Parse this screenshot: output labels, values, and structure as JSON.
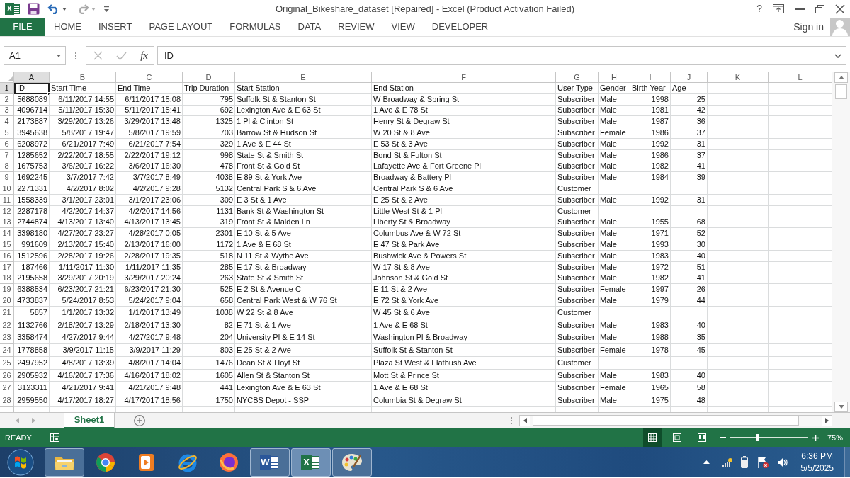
{
  "title_bar": {
    "app_letter": "X",
    "title": "Original_Bikeshare_dataset [Repaired] - Excel (Product Activation Failed)",
    "help": "?"
  },
  "ribbon": {
    "tabs": [
      {
        "label": "FILE",
        "kind": "file"
      },
      {
        "label": "HOME",
        "kind": "tab"
      },
      {
        "label": "INSERT",
        "kind": "tab"
      },
      {
        "label": "PAGE LAYOUT",
        "kind": "tab"
      },
      {
        "label": "FORMULAS",
        "kind": "tab"
      },
      {
        "label": "DATA",
        "kind": "tab"
      },
      {
        "label": "REVIEW",
        "kind": "tab"
      },
      {
        "label": "VIEW",
        "kind": "tab"
      },
      {
        "label": "DEVELOPER",
        "kind": "tab"
      }
    ],
    "account": {
      "label": "Sign in"
    }
  },
  "formula_bar": {
    "name_box": "A1",
    "function_label": "fx",
    "value": "ID"
  },
  "sheet": {
    "columns": [
      {
        "label": "A",
        "kind": "number",
        "selected": true
      },
      {
        "label": "B",
        "kind": "number",
        "selected": false
      },
      {
        "label": "C",
        "kind": "number",
        "selected": false
      },
      {
        "label": "D",
        "kind": "number",
        "selected": false
      },
      {
        "label": "E",
        "kind": "text",
        "selected": false
      },
      {
        "label": "F",
        "kind": "text",
        "selected": false
      },
      {
        "label": "G",
        "kind": "text",
        "selected": false
      },
      {
        "label": "H",
        "kind": "text",
        "selected": false
      },
      {
        "label": "I",
        "kind": "number",
        "selected": false
      },
      {
        "label": "J",
        "kind": "number",
        "selected": false
      },
      {
        "label": "K",
        "selected": false
      },
      {
        "label": "L",
        "selected": false
      }
    ],
    "rows": [
      {
        "number": "1",
        "kind": "header",
        "selected": true,
        "cells": [
          "ID",
          "Start Time",
          "End Time",
          "Trip Duration",
          "Start Station",
          "End Station",
          "User Type",
          "Gender",
          "Birth Year",
          "Age"
        ]
      },
      {
        "number": "2",
        "kind": "data",
        "selected": false,
        "cells": [
          "5688089",
          "6/11/2017 14:55",
          "6/11/2017 15:08",
          "795",
          "Suffolk St & Stanton St",
          "W Broadway & Spring St",
          "Subscriber",
          "Male",
          "1998",
          "25"
        ]
      },
      {
        "number": "3",
        "kind": "data",
        "selected": false,
        "cells": [
          "4096714",
          "5/11/2017 15:30",
          "5/11/2017 15:41",
          "692",
          "Lexington Ave & E 63 St",
          "1 Ave & E 78 St",
          "Subscriber",
          "Male",
          "1981",
          "42"
        ]
      },
      {
        "number": "4",
        "kind": "data",
        "selected": false,
        "cells": [
          "2173887",
          "3/29/2017 13:26",
          "3/29/2017 13:48",
          "1325",
          "1 Pl & Clinton St",
          "Henry St & Degraw St",
          "Subscriber",
          "Male",
          "1987",
          "36"
        ]
      },
      {
        "number": "5",
        "kind": "data",
        "selected": false,
        "cells": [
          "3945638",
          "5/8/2017 19:47",
          "5/8/2017 19:59",
          "703",
          "Barrow St & Hudson St",
          "W 20 St & 8 Ave",
          "Subscriber",
          "Female",
          "1986",
          "37"
        ]
      },
      {
        "number": "6",
        "kind": "data",
        "selected": false,
        "cells": [
          "6208972",
          "6/21/2017 7:49",
          "6/21/2017 7:54",
          "329",
          "1 Ave & E 44 St",
          "E 53 St & 3 Ave",
          "Subscriber",
          "Male",
          "1992",
          "31"
        ]
      },
      {
        "number": "7",
        "kind": "data",
        "selected": false,
        "cells": [
          "1285652",
          "2/22/2017 18:55",
          "2/22/2017 19:12",
          "998",
          "State St & Smith St",
          "Bond St & Fulton St",
          "Subscriber",
          "Male",
          "1986",
          "37"
        ]
      },
      {
        "number": "8",
        "kind": "data",
        "selected": false,
        "cells": [
          "1675753",
          "3/6/2017 16:22",
          "3/6/2017 16:30",
          "478",
          "Front St & Gold St",
          "Lafayette Ave & Fort Greene Pl",
          "Subscriber",
          "Male",
          "1982",
          "41"
        ]
      },
      {
        "number": "9",
        "kind": "data",
        "selected": false,
        "cells": [
          "1692245",
          "3/7/2017 7:42",
          "3/7/2017 8:49",
          "4038",
          "E 89 St & York Ave",
          "Broadway & Battery Pl",
          "Subscriber",
          "Male",
          "1984",
          "39"
        ]
      },
      {
        "number": "10",
        "kind": "data",
        "selected": false,
        "cells": [
          "2271331",
          "4/2/2017 8:02",
          "4/2/2017 9:28",
          "5132",
          "Central Park S & 6 Ave",
          "Central Park S & 6 Ave",
          "Customer"
        ]
      },
      {
        "number": "11",
        "kind": "data",
        "selected": false,
        "cells": [
          "1558339",
          "3/1/2017 23:01",
          "3/1/2017 23:06",
          "309",
          "E 3 St & 1 Ave",
          "E 25 St & 2 Ave",
          "Subscriber",
          "Male",
          "1992",
          "31"
        ]
      },
      {
        "number": "12",
        "kind": "data",
        "selected": false,
        "cells": [
          "2287178",
          "4/2/2017 14:37",
          "4/2/2017 14:56",
          "1131",
          "Bank St & Washington St",
          "Little West St & 1 Pl",
          "Customer"
        ]
      },
      {
        "number": "13",
        "kind": "data",
        "selected": false,
        "cells": [
          "2744874",
          "4/13/2017 13:40",
          "4/13/2017 13:45",
          "319",
          "Front St & Maiden Ln",
          "Liberty St & Broadway",
          "Subscriber",
          "Male",
          "1955",
          "68"
        ]
      },
      {
        "number": "14",
        "kind": "data",
        "selected": false,
        "cells": [
          "3398180",
          "4/27/2017 23:27",
          "4/28/2017 0:05",
          "2301",
          "E 10 St & 5 Ave",
          "Columbus Ave & W 72 St",
          "Subscriber",
          "Male",
          "1971",
          "52"
        ]
      },
      {
        "number": "15",
        "kind": "data",
        "selected": false,
        "cells": [
          "991609",
          "2/13/2017 15:40",
          "2/13/2017 16:00",
          "1172",
          "1 Ave & E 68 St",
          "E 47 St & Park Ave",
          "Subscriber",
          "Male",
          "1993",
          "30"
        ]
      },
      {
        "number": "16",
        "kind": "data",
        "selected": false,
        "cells": [
          "1512596",
          "2/28/2017 19:26",
          "2/28/2017 19:35",
          "518",
          "N 11 St & Wythe Ave",
          "Bushwick Ave & Powers St",
          "Subscriber",
          "Male",
          "1983",
          "40"
        ]
      },
      {
        "number": "17",
        "kind": "data",
        "selected": false,
        "cells": [
          "187466",
          "1/11/2017 11:30",
          "1/11/2017 11:35",
          "285",
          "E 17 St & Broadway",
          "W 17 St & 8 Ave",
          "Subscriber",
          "Male",
          "1972",
          "51"
        ]
      },
      {
        "number": "18",
        "kind": "data",
        "selected": false,
        "cells": [
          "2195658",
          "3/29/2017 20:19",
          "3/29/2017 20:24",
          "263",
          "State St & Smith St",
          "Johnson St & Gold St",
          "Subscriber",
          "Male",
          "1982",
          "41"
        ]
      },
      {
        "number": "19",
        "kind": "data",
        "selected": false,
        "cells": [
          "6388534",
          "6/23/2017 21:21",
          "6/23/2017 21:30",
          "525",
          "E 2 St & Avenue C",
          "E 11 St & 2 Ave",
          "Subscriber",
          "Female",
          "1997",
          "26"
        ]
      },
      {
        "number": "20",
        "kind": "data",
        "selected": false,
        "cells": [
          "4733837",
          "5/24/2017 8:53",
          "5/24/2017 9:04",
          "658",
          "Central Park West & W 76 St",
          "E 72 St & York Ave",
          "Subscriber",
          "Male",
          "1979",
          "44"
        ]
      },
      {
        "number": "21",
        "kind": "data",
        "selected": false,
        "cells": [
          "5857",
          "1/1/2017 13:32",
          "1/1/2017 13:49",
          "1038",
          "W 22 St & 8 Ave",
          "W 45 St & 6 Ave",
          "Customer"
        ]
      },
      {
        "number": "22",
        "kind": "data",
        "selected": false,
        "cells": [
          "1132766",
          "2/18/2017 13:29",
          "2/18/2017 13:30",
          "82",
          "E 71 St & 1 Ave",
          "1 Ave & E 68 St",
          "Subscriber",
          "Male",
          "1983",
          "40"
        ]
      },
      {
        "number": "23",
        "kind": "data",
        "selected": false,
        "cells": [
          "3358474",
          "4/27/2017 9:44",
          "4/27/2017 9:48",
          "204",
          "University Pl & E 14 St",
          "Washington Pl & Broadway",
          "Subscriber",
          "Male",
          "1988",
          "35"
        ]
      },
      {
        "number": "24",
        "kind": "data",
        "selected": false,
        "cells": [
          "1778858",
          "3/9/2017 11:15",
          "3/9/2017 11:29",
          "803",
          "E 25 St & 2 Ave",
          "Suffolk St & Stanton St",
          "Subscriber",
          "Female",
          "1978",
          "45"
        ]
      },
      {
        "number": "25",
        "kind": "data",
        "selected": false,
        "cells": [
          "2497952",
          "4/8/2017 13:39",
          "4/8/2017 14:04",
          "1476",
          "Dean St & Hoyt St",
          "Plaza St West & Flatbush Ave",
          "Customer"
        ]
      },
      {
        "number": "26",
        "kind": "data",
        "selected": false,
        "cells": [
          "2905932",
          "4/16/2017 17:36",
          "4/16/2017 18:02",
          "1605",
          "Allen St & Stanton St",
          "Mott St & Prince St",
          "Subscriber",
          "Male",
          "1983",
          "40"
        ]
      },
      {
        "number": "27",
        "kind": "data",
        "selected": false,
        "cells": [
          "3123311",
          "4/21/2017 9:41",
          "4/21/2017 9:48",
          "441",
          "Lexington Ave & E 63 St",
          "1 Ave & E 68 St",
          "Subscriber",
          "Female",
          "1965",
          "58"
        ]
      },
      {
        "number": "28",
        "kind": "data",
        "selected": false,
        "cells": [
          "2959550",
          "4/17/2017 18:27",
          "4/17/2017 18:56",
          "1750",
          "NYCBS Depot - SSP",
          "Columbia St & Degraw St",
          "Subscriber",
          "Male",
          "1975",
          "48"
        ]
      }
    ]
  },
  "sheet_tabs": [
    {
      "label": "Sheet1",
      "selected": true
    }
  ],
  "status_bar": {
    "status": "READY",
    "views": [
      {
        "kind": "normal",
        "selected": true
      },
      {
        "kind": "page_layout",
        "selected": false
      },
      {
        "kind": "page_break",
        "selected": false
      }
    ],
    "zoom": {
      "level": 0.35,
      "reading": "75%"
    }
  },
  "taskbar": {
    "apps": [
      {
        "kind": "explorer",
        "running": true,
        "selected": false
      },
      {
        "kind": "chrome",
        "running": false,
        "selected": false
      },
      {
        "kind": "media",
        "running": false,
        "selected": false
      },
      {
        "kind": "ie",
        "running": false,
        "selected": false
      },
      {
        "kind": "firefox",
        "running": false,
        "selected": false
      },
      {
        "kind": "word",
        "letter": "W",
        "running": true,
        "selected": false
      },
      {
        "kind": "excel",
        "letter": "X",
        "running": true,
        "selected": true
      },
      {
        "kind": "paint",
        "running": true,
        "selected": false
      }
    ],
    "clock": {
      "time": "6:36 PM",
      "date": "5/5/2025"
    }
  }
}
